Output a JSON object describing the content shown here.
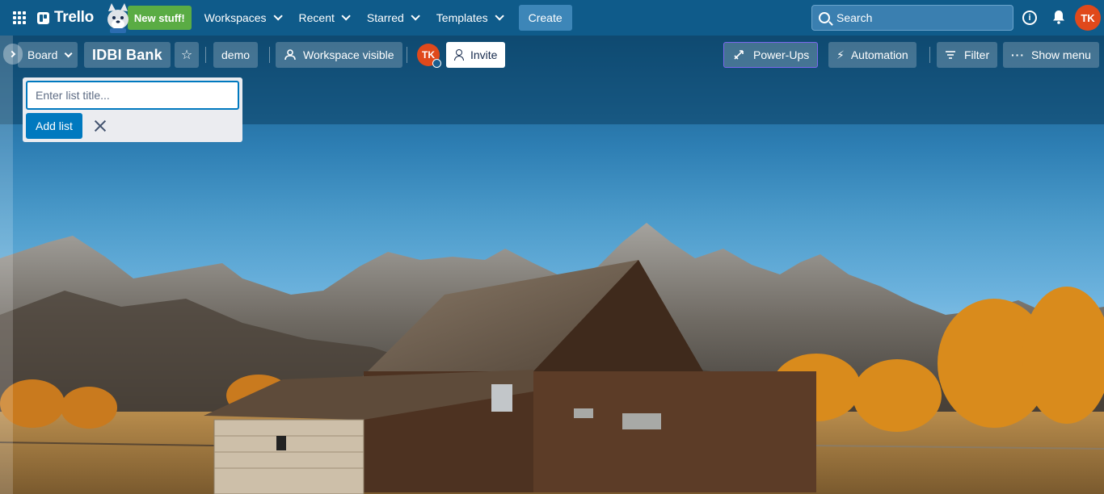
{
  "topbar": {
    "app_name": "Trello",
    "new_stuff_label": "New stuff!",
    "nav": [
      {
        "label": "Workspaces"
      },
      {
        "label": "Recent"
      },
      {
        "label": "Starred"
      },
      {
        "label": "Templates"
      }
    ],
    "create_label": "Create",
    "search_placeholder": "Search",
    "user_initials": "TK"
  },
  "board": {
    "view_label": "Board",
    "title": "IDBI Bank",
    "workspace_name": "demo",
    "visibility_label": "Workspace visible",
    "member_initials": "TK",
    "invite_label": "Invite",
    "powerups_label": "Power-Ups",
    "automation_label": "Automation",
    "filter_label": "Filter",
    "menu_label": "Show menu"
  },
  "add_list": {
    "placeholder": "Enter list title...",
    "value": "",
    "submit_label": "Add list"
  },
  "colors": {
    "nav_bg": "#0f5b8a",
    "accent": "#0079bf",
    "new_stuff": "#5aac44",
    "avatar": "#e0491b",
    "powerups_outline": "#7b68ee"
  }
}
